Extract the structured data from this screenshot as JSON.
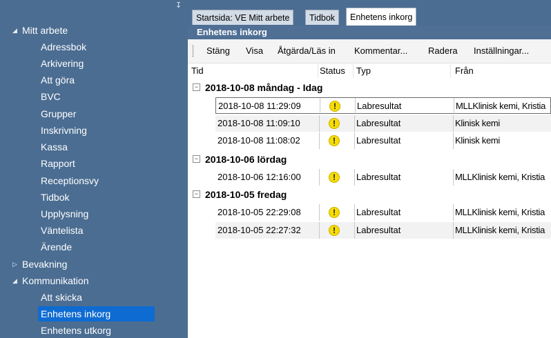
{
  "sidebar": {
    "groups": [
      {
        "label": "Mitt arbete",
        "expanded": true
      },
      {
        "label": "Bevakning",
        "expanded": false
      },
      {
        "label": "Kommunikation",
        "expanded": true
      }
    ],
    "mitt_arbete_items": [
      "Adressbok",
      "Arkivering",
      "Att göra",
      "BVC",
      "Grupper",
      "Inskrivning",
      "Kassa",
      "Rapport",
      "Receptionsvy",
      "Tidbok",
      "Upplysning",
      "Väntelista",
      "Ärende"
    ],
    "kommunikation_items": [
      "Att skicka",
      "Enhetens inkorg",
      "Enhetens utkorg"
    ],
    "selected": "Enhetens inkorg",
    "pin_icon": "pin-icon"
  },
  "tabs": [
    {
      "label": "Startsida: VE Mitt arbete",
      "active": false
    },
    {
      "label": "Tidbok",
      "active": false
    },
    {
      "label": "Enhetens inkorg",
      "active": true
    }
  ],
  "panel": {
    "title": "Enhetens inkorg"
  },
  "toolbar": [
    "Stäng",
    "Visa",
    "Åtgärda/Läs in",
    "Kommentar...",
    "Radera",
    "Inställningar..."
  ],
  "columns": [
    "Tid",
    "Status",
    "Typ",
    "Från"
  ],
  "groups": [
    {
      "label": "2018-10-08  måndag - Idag",
      "rows": [
        {
          "time": "2018-10-08 11:29:09",
          "status": "!",
          "type": "Labresultat",
          "from": "MLLKlinisk kemi, Kristia"
        },
        {
          "time": "2018-10-08 11:09:10",
          "status": "!",
          "type": "Labresultat",
          "from": "Klinisk kemi"
        },
        {
          "time": "2018-10-08 11:08:02",
          "status": "!",
          "type": "Labresultat",
          "from": "Klinisk kemi"
        }
      ]
    },
    {
      "label": "2018-10-06  lördag",
      "rows": [
        {
          "time": "2018-10-06 12:16:00",
          "status": "!",
          "type": "Labresultat",
          "from": "MLLKlinisk kemi, Kristia"
        }
      ]
    },
    {
      "label": "2018-10-05  fredag",
      "rows": [
        {
          "time": "2018-10-05 22:29:08",
          "status": "!",
          "type": "Labresultat",
          "from": "MLLKlinisk kemi, Kristia"
        },
        {
          "time": "2018-10-05 22:27:32",
          "status": "!",
          "type": "Labresultat",
          "from": "MLLKlinisk kemi, Kristia"
        }
      ]
    }
  ],
  "colors": {
    "sidebar": "#4b6d92",
    "selected": "#0e6bd1",
    "warning": "#f6dc04"
  }
}
